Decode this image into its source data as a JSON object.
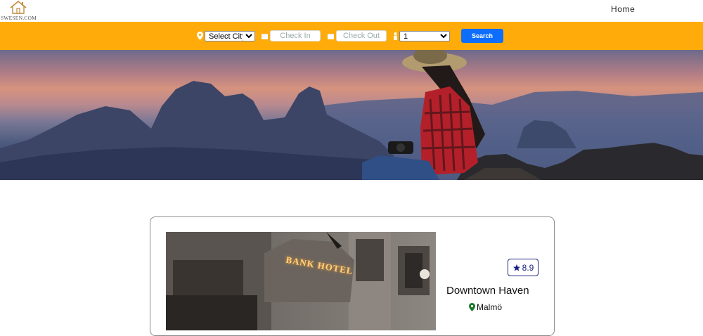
{
  "brand": {
    "logo_text": "SWESEN.COM"
  },
  "nav": {
    "home_label": "Home"
  },
  "search": {
    "city_selected": "Select City",
    "check_in_placeholder": "Check In",
    "check_out_placeholder": "Check Out",
    "guests_selected": "1",
    "search_label": "Search"
  },
  "colors": {
    "searchbar_bg": "#ffac0a",
    "button_bg": "#0d6efd",
    "rating_color": "#1a237e",
    "pin_green": "#1b7a2a"
  },
  "hotel": {
    "rating": "8.9",
    "name": "Downtown Haven",
    "city": "Malmö",
    "sign_text": "BANK HOTEL"
  }
}
